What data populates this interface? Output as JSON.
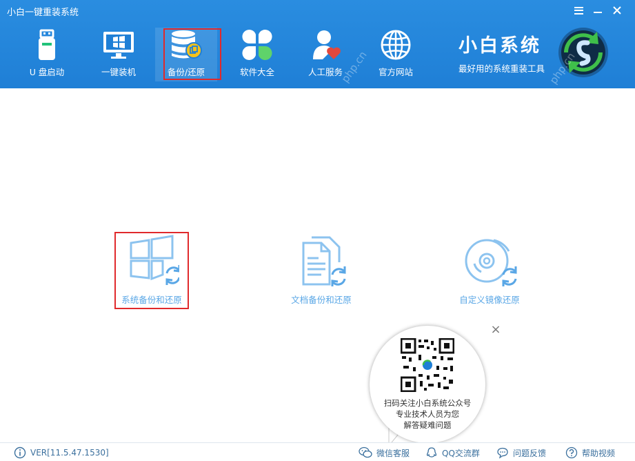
{
  "window": {
    "title": "小白一键重装系统"
  },
  "nav": [
    {
      "id": "usb",
      "label": "U 盘启动",
      "icon": "usb-drive-icon"
    },
    {
      "id": "onekey",
      "label": "一键装机",
      "icon": "windows-monitor-icon"
    },
    {
      "id": "backup",
      "label": "备份/还原",
      "icon": "database-backup-icon",
      "active": true
    },
    {
      "id": "software",
      "label": "软件大全",
      "icon": "clover-apps-icon"
    },
    {
      "id": "service",
      "label": "人工服务",
      "icon": "user-heart-icon"
    },
    {
      "id": "website",
      "label": "官方网站",
      "icon": "globe-icon"
    }
  ],
  "brand": {
    "title": "小白系统",
    "subtitle": "最好用的系统重装工具",
    "logo": "refresh-globe-logo"
  },
  "watermark": "php.cn",
  "features": [
    {
      "id": "system",
      "label": "系统备份和还原",
      "icon": "windows-restore-icon",
      "highlighted": true
    },
    {
      "id": "document",
      "label": "文档备份和还原",
      "icon": "document-restore-icon"
    },
    {
      "id": "image",
      "label": "自定义镜像还原",
      "icon": "disc-restore-icon"
    }
  ],
  "qr_popup": {
    "lines": [
      "扫码关注小白系统公众号",
      "专业技术人员为您",
      "解答疑难问题"
    ],
    "close": "×"
  },
  "footer": {
    "version": "VER[11.5.47.1530]",
    "links": [
      {
        "id": "wechat",
        "label": "微信客服",
        "icon": "wechat-icon"
      },
      {
        "id": "qq",
        "label": "QQ交流群",
        "icon": "qq-icon"
      },
      {
        "id": "feedback",
        "label": "问题反馈",
        "icon": "chat-bubble-icon"
      },
      {
        "id": "help",
        "label": "帮助视频",
        "icon": "help-icon"
      }
    ]
  },
  "colors": {
    "header": "#1f7fd6",
    "accent": "#5aa7e6",
    "highlight": "#e0292b",
    "footer_text": "#3a6f9d"
  }
}
